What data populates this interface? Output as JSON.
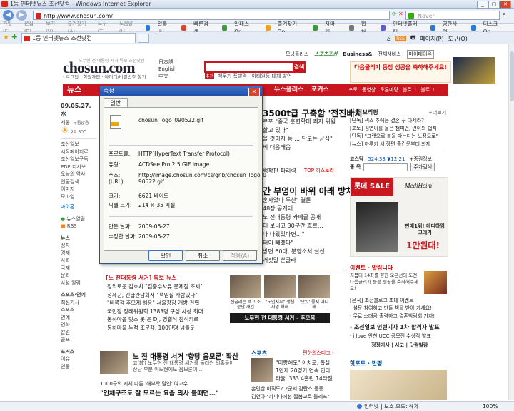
{
  "window": {
    "title": "1등 인터넷뉴스 조선닷컴 - Windows Internet Explorer",
    "min": "_",
    "max": "□",
    "close": "✕"
  },
  "address": {
    "url": "http://www.chosun.com/",
    "search_placeholder": "Naver"
  },
  "menu": {
    "items": [
      "파일(F)",
      "편집(E)",
      "보기(V)",
      "즐겨찾기(A)",
      "도구(T)",
      "도움말(H)"
    ],
    "toolbar": [
      {
        "label": "알툴바",
        "color": "#2a7ad8"
      },
      {
        "label": "빠른검색",
        "color": "#d8452f"
      },
      {
        "label": "알패스On",
        "color": "#3a9a3a"
      },
      {
        "label": "즐겨찾기On",
        "color": "#f0a020"
      },
      {
        "label": "지마켓",
        "color": "#3a9a3a"
      },
      {
        "label": "캡쳐",
        "color": "#777777"
      },
      {
        "label": "인터넷플러킹",
        "color": "#5c5cd8"
      },
      {
        "label": "영한사전",
        "color": "#2a7ad8"
      },
      {
        "label": "디스크On",
        "color": "#2a7ad8"
      }
    ]
  },
  "tab": {
    "title": "1등 인터넷뉴스 조선닷컴"
  },
  "cmd": {
    "home": "⌂",
    "rss": "RSS",
    "print": "🖶",
    "page": "페이지(P)",
    "tools": "도구(O)"
  },
  "site": {
    "logo": "chosun.com",
    "tagline": "노무현 전 대통령 서거 특보 조선닷컴",
    "login_links": "· 로그인 · 회원가입 · 아이디/비밀번호 찾기",
    "langs": [
      "日本語",
      "English",
      "中文"
    ],
    "search_btn": "검색",
    "search_tag": "추천",
    "search_hint": "백두기 폭발력 · 이태원동 대체 발언",
    "top_links": [
      "모닝플러스",
      "스포츠조선"
    ],
    "top_links2": [
      "Business&",
      "전체서비스",
      "마이페이온"
    ],
    "ad_top": "다음글리기 등정 성공을 축하해주세요!",
    "nav": [
      {
        "label": "뉴스"
      },
      {
        "label": "뉴스플러스"
      },
      {
        "label": "포커스"
      }
    ],
    "nav_right": [
      "포토",
      "동영상",
      "토론마당",
      "블로그",
      "블로그"
    ],
    "date": "09.05.27.水",
    "weather_city": "서울",
    "weather_desc": "구름많음",
    "weather_temp": "29.5℃",
    "left_links": [
      "조선일보",
      "시작페이지로",
      "조선일보구독",
      "PDF·지시보",
      "오늘의 역사",
      "인물검색",
      "이미지",
      "모바일"
    ],
    "myinfo": "마이홈",
    "news_alarm": "뉴스알림",
    "rss": "RSS",
    "sections": {
      "news": "뉴스",
      "news_items": [
        "정치",
        "경제",
        "사회",
        "국제",
        "문화",
        "사설·칼럼"
      ],
      "sports": "스포츠·연예",
      "sports_items": [
        "최신기사",
        "스포츠",
        "연예",
        "영화",
        "칼럼",
        "골프"
      ],
      "focus": "포커스",
      "focus_items": [
        "이슈",
        "인물"
      ]
    },
    "headline1": "3500t급 구축함 '전진배치'",
    "sub1": [
      "르포 \"중국 훈련확대 쾌지 위원",
      "살고 있다\"",
      "을 것이지 등 ... 단도는 군심\"",
      "비 대응태움"
    ],
    "sub1b": "백작판 파리력",
    "top_hot": "TOP 히스토리",
    "headline2": "간 부엉이 바위 아래 방치\"",
    "sub2": [
      "혼자었다 두산\" 결론",
      "48장 공개돼",
      "노 전대통령 카페글 공개",
      "더 보내고 30분간 흐르…",
      "나 나왔었다면…\"",
      "터이 빼겠다\"",
      "방면 60대, 분향소서 실신",
      "거짓말 뿐글라"
    ],
    "special": "[노 전대통령 서거] 특보 뉴스",
    "special_items": [
      "정의로운 김호치 \"김충수사유 문제점 조세\"",
      "정세군, 긴급간담회서 \"책임질 사람있다\"",
      "\"비쪽적 추모제 허용\" 서울광장 개방 건엽",
      "국민장 장례위원회 1383명 구성 사상 최대",
      "봉하마을 탓소 못 운 DJ, 영결식 참석키로",
      "봉하마을 누적 조문객, 100만명 넘들듯"
    ],
    "photo_caps": [
      "선급리는 백고 조문만 깨건",
      "\"노인지부\" 생천사명 화해",
      "'맛있' 좋지 아니해"
    ],
    "photo_band": "노무현 전 대통령 서거 - 추모목",
    "bottom_headline": "노 전 대통령 서거 '향당 음모론' 확산",
    "bottom_sub": "고(故) 노무현 전 대통령 세거를 둘러싼 의혹들이 상당 부분 아도현에도 음모론이…",
    "bottom_hd2": "\"인체구조도 잘 모르는 요즘 의사 볼때면…\"",
    "bottom_small": "1000구의 시체 다룬 '해부학 달인' 여교수",
    "sports_hd": "스포츠",
    "sports_sub": "편하의스디그 ›",
    "sports_items": [
      "\"미량해도\" 이치로, 톱실",
      "1만제 20경기 연속 안타",
      "타율 .333 4홈런 14타점"
    ],
    "sports_bottom": [
      "손민한 아직도? 2군서 감탄스 등등",
      "김연아 \"카니다에선 짧봄교로 톨레프\""
    ],
    "briefing": "뉴플 브리핑",
    "briefing_more": "+더보기",
    "briefing_items": [
      "[단독] 색스 추에는 결혼 꾸 아세라?",
      "[포토] 김연아를 들은 챔피언, 연아의 법칙",
      "[단독] \"그랬으로 불울 박는다는 노정으로\"",
      "[뉴스] 하루키 새 장편 출간문부터 화제"
    ],
    "market": "코스닥",
    "market_val": "524.33 ▼12.21",
    "market_more": "+증권정보",
    "stock_label": "종 목",
    "stock_btn": "주가검색",
    "ad1": "롯데 SALE",
    "ad1b": "MediHeim",
    "ad1c": "판매1위! 메디하임 고데기",
    "ad1d": "1만원대!",
    "event_hd": "이벤트 · 알림니다",
    "event_text": "치몸터 14좌를 향한 오은선의 도전 다음글리기 등정 성공을 축하해주세요!",
    "event_items": [
      "[온국] 조선블로그 초대 이벤트",
      "· 설문 참여하고 만들 책을 받아 가세요!",
      "· 무료 소대금 출력하고 결혼박람회 가자!"
    ],
    "event2": "· 조선일보 인턴기자 1차 합격자 발표",
    "event3": "· i love 인천 UCC 공모전 수상작 발표",
    "event4": "정정기사 | 사고 | 닷컴일람",
    "photo_hd": "핫포토 · 만평",
    "status_left": "",
    "status_zone": "인터넷 | 보호 모드: 해제",
    "status_zoom": "100%"
  },
  "dialog": {
    "title": "속성",
    "close": "✕",
    "tab": "일반",
    "filename": "chosun_logo_090522.gif",
    "rows": [
      {
        "label": "프로토콜:",
        "value": "HTTP(HyperText Transfer Protocol)"
      },
      {
        "label": "유형:",
        "value": "ACDSee Pro 2.5 GIF Image"
      },
      {
        "label": "주소:",
        "value": "http://image.chosun.com/cs/gnb/chosun_logo_0"
      },
      {
        "label": "(URL)",
        "value": "90522.gif"
      },
      {
        "label": "크기:",
        "value": "6621 바이트"
      },
      {
        "label": "픽셀 크기:",
        "value": "214 × 35 픽셀"
      },
      {
        "label": "만든 날짜:",
        "value": "2009-05-27"
      },
      {
        "label": "수정한 날짜:",
        "value": "2009-05-27"
      }
    ],
    "ok": "확인",
    "cancel": "취소",
    "apply": "적용(A)"
  }
}
